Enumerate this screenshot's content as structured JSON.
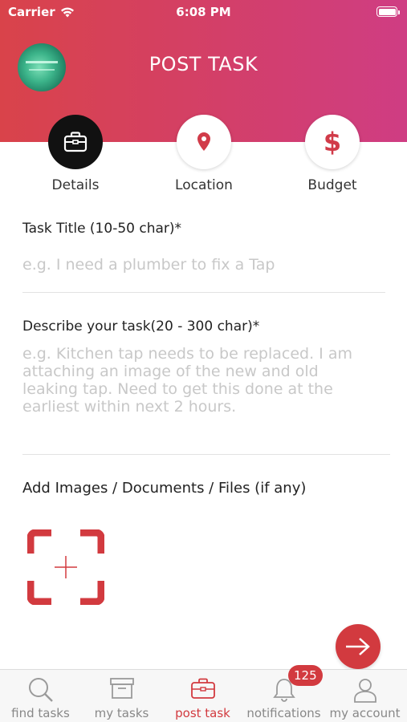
{
  "status_bar": {
    "carrier": "Carrier",
    "time": "6:08 PM"
  },
  "header": {
    "title": "POST TASK",
    "gradient_start": "#d9434a",
    "gradient_end": "#cf3d83"
  },
  "steps": [
    {
      "label": "Details",
      "icon": "briefcase-icon",
      "active": true
    },
    {
      "label": "Location",
      "icon": "location-pin-icon",
      "active": false
    },
    {
      "label": "Budget",
      "icon": "dollar-icon",
      "active": false,
      "glyph": "$"
    }
  ],
  "form": {
    "title_label": "Task Title (10-50 char)*",
    "title_placeholder": "e.g. I need a plumber to fix a Tap",
    "description_label": "Describe your task(20 - 300 char)*",
    "description_placeholder_lines": [
      "e.g. Kitchen tap needs to be replaced. I am",
      "attaching an image of the new and old",
      "leaking tap. Need to get this done at the",
      "earliest within next 2 hours."
    ],
    "attachments_label": "Add Images / Documents / Files (if any)"
  },
  "tabs": [
    {
      "label": "find tasks",
      "icon": "search-icon",
      "active": false
    },
    {
      "label": "my tasks",
      "icon": "archive-box-icon",
      "active": false
    },
    {
      "label": "post task",
      "icon": "briefcase-icon",
      "active": true
    },
    {
      "label": "notifications",
      "icon": "bell-icon",
      "active": false,
      "badge": "125"
    },
    {
      "label": "my account",
      "icon": "user-icon",
      "active": false
    }
  ],
  "colors": {
    "accent": "#d23a3f",
    "placeholder": "#c8c8c8"
  }
}
